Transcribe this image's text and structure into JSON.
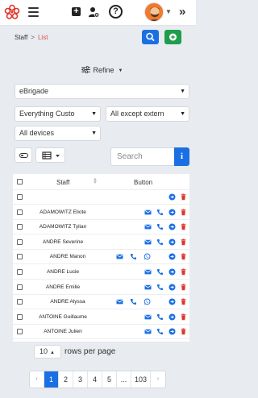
{
  "header": {
    "logo_icon": "ebrigade-flower-logo",
    "menu_icon": "hamburger-icon",
    "add_icon": "plus-square-icon",
    "user_add_icon": "user-plus-icon",
    "help_label": "?",
    "expand_label": "»"
  },
  "breadcrumb": {
    "root": "Staff",
    "separator": ">",
    "current": "List"
  },
  "colors": {
    "primary": "#1a6fe3",
    "success": "#1f9d4c",
    "danger": "#e0342a",
    "accent_text": "#e05050"
  },
  "filters": {
    "refine_label": "Refine",
    "section": "eBrigade",
    "scope": "Everything Custo",
    "exclusion": "All except extern",
    "devices": "All devices"
  },
  "search": {
    "placeholder": "Search",
    "info_label": "i"
  },
  "table": {
    "columns": {
      "staff": "Staff",
      "button": "Button"
    },
    "rows": [
      {
        "name": "",
        "mail": false,
        "phone": false,
        "whatsapp": false,
        "indent": false
      },
      {
        "name": "ADAMOWITZ Eliote",
        "mail": true,
        "phone": true,
        "whatsapp": false,
        "indent": false
      },
      {
        "name": "ADAMOWITZ Tylian",
        "mail": true,
        "phone": true,
        "whatsapp": false,
        "indent": false
      },
      {
        "name": "ANDRE Severine",
        "mail": true,
        "phone": true,
        "whatsapp": false,
        "indent": false
      },
      {
        "name": "ANDRE Manon",
        "mail": true,
        "phone": true,
        "whatsapp": true,
        "indent": true
      },
      {
        "name": "ANDRE Lucie",
        "mail": true,
        "phone": true,
        "whatsapp": false,
        "indent": false
      },
      {
        "name": "ANDRE Emilie",
        "mail": true,
        "phone": true,
        "whatsapp": false,
        "indent": false
      },
      {
        "name": "ANDRE Alyssa",
        "mail": true,
        "phone": true,
        "whatsapp": true,
        "indent": true
      },
      {
        "name": "ANTOINE Guillaume",
        "mail": true,
        "phone": true,
        "whatsapp": false,
        "indent": false
      },
      {
        "name": "ANTOINE Julien",
        "mail": true,
        "phone": true,
        "whatsapp": false,
        "indent": false
      }
    ]
  },
  "pagination": {
    "rows_per_page_value": "10",
    "rows_per_page_label": "rows per page",
    "prev": "‹",
    "pages": [
      "1",
      "2",
      "3",
      "4",
      "5",
      "...",
      "103"
    ],
    "active_page": "1",
    "next": "›"
  }
}
